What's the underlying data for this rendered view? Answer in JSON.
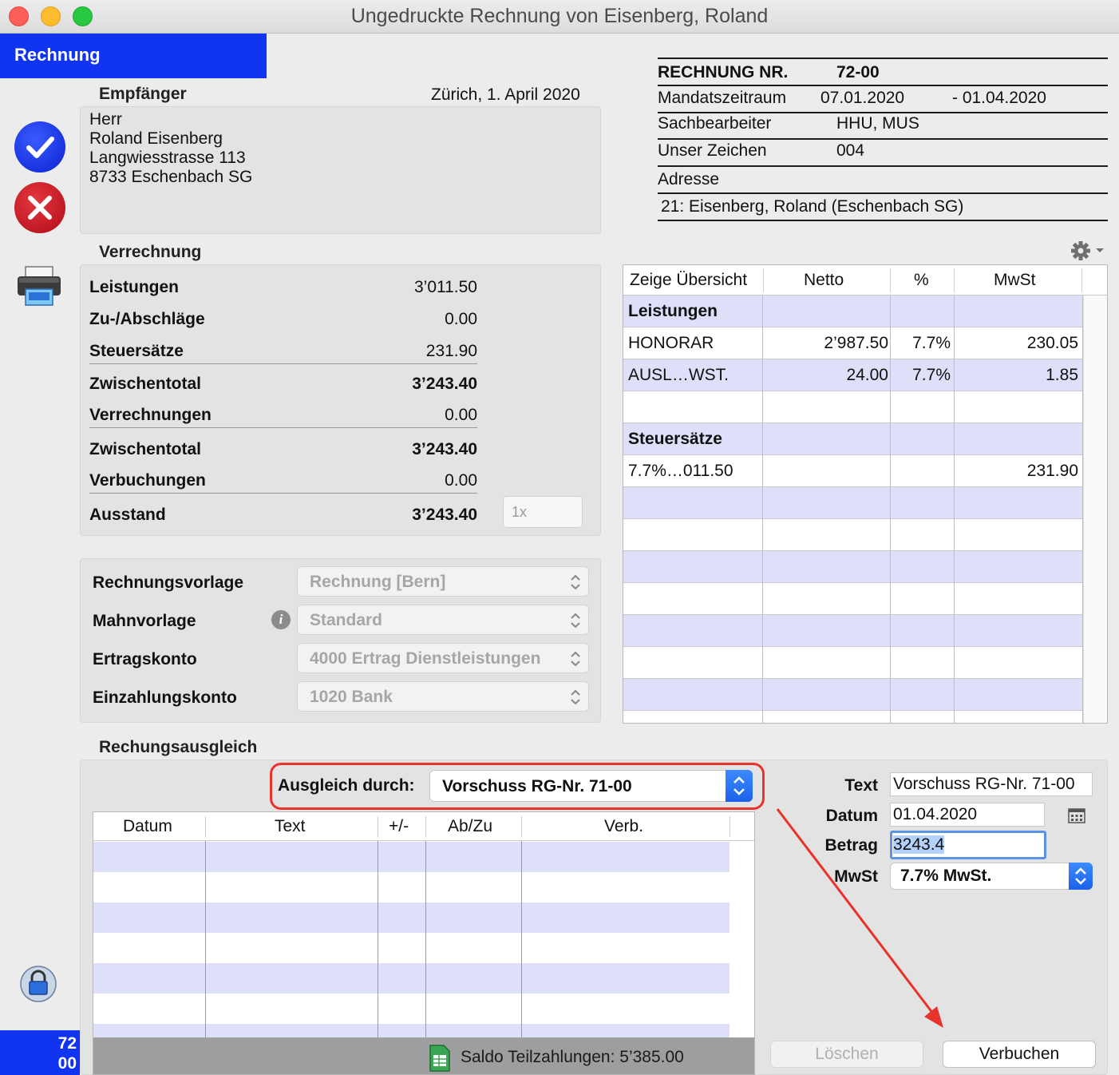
{
  "window": {
    "title": "Ungedruckte Rechnung von Eisenberg, Roland"
  },
  "sidebar": {
    "tab_label": "Rechnung",
    "badge_line1": "72",
    "badge_line2": "00"
  },
  "recipient": {
    "section_label": "Empfänger",
    "place_date": "Zürich, 1. April 2020",
    "lines": [
      "Herr",
      "Roland Eisenberg",
      "Langwiesstrasse 113",
      "8733 Eschenbach SG"
    ]
  },
  "verrechnung": {
    "section_label": "Verrechnung",
    "rows": [
      {
        "label": "Leistungen",
        "value": "3’011.50"
      },
      {
        "label": "Zu-/Abschläge",
        "value": "0.00"
      },
      {
        "label": "Steuersätze",
        "value": "231.90"
      },
      {
        "label": "Zwischentotal",
        "value": "3’243.40"
      },
      {
        "label": "Verrechnungen",
        "value": "0.00"
      },
      {
        "label": "Zwischentotal",
        "value": "3’243.40"
      },
      {
        "label": "Verbuchungen",
        "value": "0.00"
      },
      {
        "label": "Ausstand",
        "value": "3’243.40"
      }
    ],
    "copies_placeholder": "1x"
  },
  "settings": {
    "rows": [
      {
        "label": "Rechnungsvorlage",
        "value": "Rechnung [Bern]"
      },
      {
        "label": "Mahnvorlage",
        "value": "Standard"
      },
      {
        "label": "Ertragskonto",
        "value": "4000 Ertrag Dienstleistungen"
      },
      {
        "label": "Einzahlungskonto",
        "value": "1020 Bank"
      }
    ]
  },
  "invoice_header": {
    "number_label": "RECHNUNG NR.",
    "number_value": "72-00",
    "period_label": "Mandatszeitraum",
    "period_from": "07.01.2020",
    "period_to": "- 01.04.2020",
    "clerk_label": "Sachbearbeiter",
    "clerk_value": "HHU, MUS",
    "reference_label": "Unser Zeichen",
    "reference_value": "004",
    "address_label": "Adresse",
    "address_value": "21: Eisenberg, Roland (Eschenbach SG)"
  },
  "overview": {
    "columns": [
      "Zeige Übersicht",
      "Netto",
      "%",
      "MwSt"
    ],
    "rows": [
      {
        "name": "Leistungen",
        "netto": "",
        "pct": "",
        "mwst": "",
        "bold": true
      },
      {
        "name": "HONORAR",
        "netto": "2’987.50",
        "pct": "7.7%",
        "mwst": "230.05",
        "bold": false
      },
      {
        "name": "AUSL…WST.",
        "netto": "24.00",
        "pct": "7.7%",
        "mwst": "1.85",
        "bold": false
      },
      {
        "name": "",
        "netto": "",
        "pct": "",
        "mwst": "",
        "bold": false
      },
      {
        "name": "Steuersätze",
        "netto": "",
        "pct": "",
        "mwst": "",
        "bold": true
      },
      {
        "name": "7.7%…011.50",
        "netto": "",
        "pct": "",
        "mwst": "231.90",
        "bold": false
      }
    ]
  },
  "settlement": {
    "section_label": "Rechungsausgleich",
    "method_label": "Ausgleich durch:",
    "method_value": "Vorschuss RG-Nr. 71-00",
    "columns": [
      "Datum",
      "Text",
      "+/-",
      "Ab/Zu",
      "Verb."
    ],
    "saldo_text": "Saldo Teilzahlungen: 5’385.00"
  },
  "entry_form": {
    "text_label": "Text",
    "text_value": "Vorschuss RG-Nr. 71-00",
    "date_label": "Datum",
    "date_value": "01.04.2020",
    "amount_label": "Betrag",
    "amount_value": "3243.4",
    "vat_label": "MwSt",
    "vat_value": "7.7% MwSt.",
    "delete_label": "Löschen",
    "post_label": "Verbuchen"
  },
  "colors": {
    "accent_blue": "#1034f0",
    "row_lavender": "#dedff9",
    "annotation_red": "#e8322c"
  },
  "icons": [
    "checkmark-icon",
    "close-icon",
    "printer-icon",
    "lock-icon",
    "gear-icon",
    "info-icon",
    "calendar-icon",
    "spreadsheet-icon",
    "chevron-updown-icon"
  ]
}
